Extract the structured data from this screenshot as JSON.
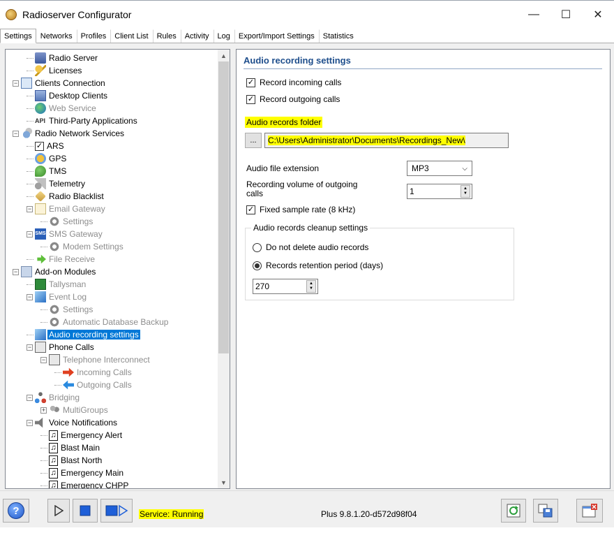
{
  "window": {
    "title": "Radioserver Configurator",
    "minimize": "—",
    "maximize": "☐",
    "close": "✕"
  },
  "tabs": [
    "Settings",
    "Networks",
    "Profiles",
    "Client List",
    "Rules",
    "Activity",
    "Log",
    "Export/Import Settings",
    "Statistics"
  ],
  "tree": {
    "items": [
      {
        "label": "Radio Server",
        "icon": "server-icon"
      },
      {
        "label": "Licenses",
        "icon": "key-icon"
      },
      {
        "label": "Clients Connection",
        "icon": "network-icon"
      },
      {
        "label": "Desktop Clients",
        "icon": "monitor-icon"
      },
      {
        "label": "Web Service",
        "icon": "globe-icon"
      },
      {
        "label": "Third-Party Applications",
        "icon": "api-icon",
        "icon_text": "API"
      },
      {
        "label": "Radio Network Services",
        "icon": "services-icon"
      },
      {
        "label": "ARS",
        "icon": "checklist-icon"
      },
      {
        "label": "GPS",
        "icon": "gps-icon"
      },
      {
        "label": "TMS",
        "icon": "tms-icon"
      },
      {
        "label": "Telemetry",
        "icon": "telemetry-icon"
      },
      {
        "label": "Radio Blacklist",
        "icon": "tag-icon"
      },
      {
        "label": "Email Gateway",
        "icon": "email-icon"
      },
      {
        "label": "Settings",
        "icon": "gear-icon"
      },
      {
        "label": "SMS Gateway",
        "icon": "sms-icon",
        "icon_text": "SMS"
      },
      {
        "label": "Modem Settings",
        "icon": "gear-icon"
      },
      {
        "label": "File Receive",
        "icon": "arrow-icon"
      },
      {
        "label": "Add-on Modules",
        "icon": "modules-icon"
      },
      {
        "label": "Tallysman",
        "icon": "tallysman-icon"
      },
      {
        "label": "Event Log",
        "icon": "log-icon"
      },
      {
        "label": "Settings",
        "icon": "gear-icon"
      },
      {
        "label": "Automatic Database Backup",
        "icon": "gear-icon"
      },
      {
        "label": "Audio recording settings",
        "icon": "audio-icon"
      },
      {
        "label": "Phone Calls",
        "icon": "phone-icon"
      },
      {
        "label": "Telephone Interconnect",
        "icon": "phone-icon"
      },
      {
        "label": "Incoming Calls",
        "icon": "arrow-right-icon"
      },
      {
        "label": "Outgoing Calls",
        "icon": "arrow-left-icon"
      },
      {
        "label": "Bridging",
        "icon": "bridge-icon"
      },
      {
        "label": "MultiGroups",
        "icon": "groups-icon"
      },
      {
        "label": "Voice Notifications",
        "icon": "speaker-icon"
      },
      {
        "label": "Emergency Alert",
        "icon": "music-note-icon"
      },
      {
        "label": "Blast Main",
        "icon": "music-note-icon"
      },
      {
        "label": "Blast North",
        "icon": "music-note-icon"
      },
      {
        "label": "Emergency Main",
        "icon": "music-note-icon"
      },
      {
        "label": "Emergency CHPP",
        "icon": "music-note-icon"
      }
    ]
  },
  "panel": {
    "title": "Audio recording settings",
    "record_incoming": "Record incoming calls",
    "record_outgoing": "Record outgoing calls",
    "folder_label": "Audio records folder",
    "browse": "...",
    "folder_path": "C:\\Users\\Administrator\\Documents\\Recordings_New\\",
    "ext_label": "Audio file extension",
    "ext_value": "MP3",
    "volume_label_1": "Recording volume of outgoing",
    "volume_label_2": "calls",
    "volume_value": "1",
    "fixed_rate": "Fixed sample rate (8 kHz)",
    "cleanup_title": "Audio records cleanup settings",
    "no_delete": "Do not delete audio records",
    "retention": "Records retention period (days)",
    "retention_value": "270"
  },
  "bottom": {
    "status": "Service: Running",
    "version": "Plus 9.8.1.20-d572d98f04"
  },
  "colors": {
    "selection": "#0078d7",
    "highlight": "#ffff00",
    "header_text": "#1e4e8c"
  }
}
